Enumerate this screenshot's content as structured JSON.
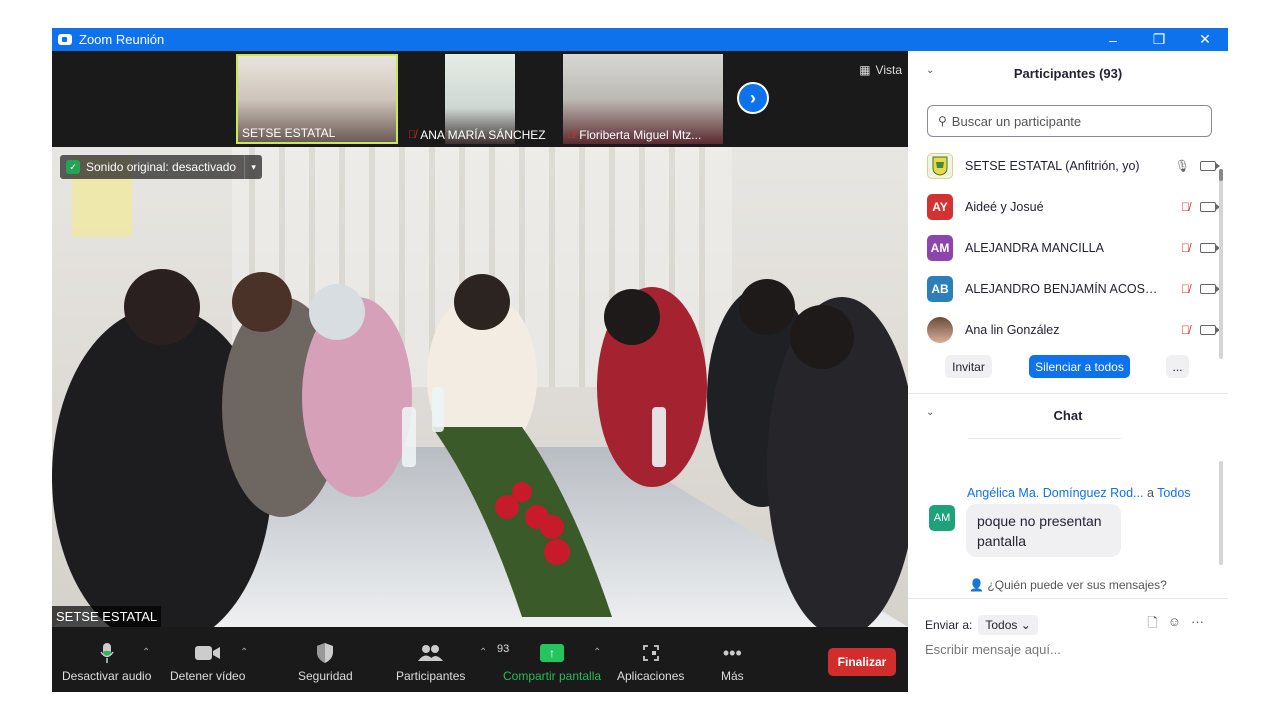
{
  "window": {
    "title": "Zoom Reunión",
    "controls": {
      "minimize": "–",
      "restore": "❐",
      "close": "✕"
    }
  },
  "strip": {
    "thumbnails": [
      {
        "label": "SETSE ESTATAL",
        "muted": false
      },
      {
        "label": "ANA MARÍA SÁNCHEZ",
        "muted": true
      },
      {
        "label": "Floriberta Miguel Mtz...",
        "muted": true
      }
    ],
    "view_label": "Vista"
  },
  "main_video": {
    "sound_status": "Sonido original: desactivado",
    "speaker_name": "SETSE ESTATAL"
  },
  "toolbar": {
    "audio_label": "Desactivar audio",
    "video_label": "Detener vídeo",
    "security_label": "Seguridad",
    "participants_label": "Participantes",
    "participants_count": "93",
    "share_label": "Compartir pantalla",
    "apps_label": "Aplicaciones",
    "more_label": "Más",
    "end_label": "Finalizar"
  },
  "participants_panel": {
    "title": "Participantes (93)",
    "search_placeholder": "Buscar un participante",
    "items": [
      {
        "initials": "",
        "name": "SETSE ESTATAL (Anfitrión, yo)",
        "color": "#f1f5e0",
        "muted": false
      },
      {
        "initials": "AY",
        "name": "Aideé y Josué",
        "color": "#d23232",
        "muted": true
      },
      {
        "initials": "AM",
        "name": "ALEJANDRA MANCILLA",
        "color": "#8e44ad",
        "muted": true
      },
      {
        "initials": "AB",
        "name": "ALEJANDRO BENJAMÍN ACOST...",
        "color": "#2c7fb8",
        "muted": true
      },
      {
        "initials": "",
        "name": "Ana lin González",
        "color": "#b07a5a",
        "muted": true
      }
    ],
    "invite_label": "Invitar",
    "mute_all_label": "Silenciar a todos",
    "more_label": "..."
  },
  "chat_panel": {
    "title": "Chat",
    "message": {
      "sender": "Angélica Ma. Domínguez Rod...",
      "to_prefix": "a",
      "to": "Todos",
      "avatar_initials": "AM",
      "text": "poque no presentan pantalla"
    },
    "who_sees": "¿Quién puede ver sus mensajes?",
    "send_to_label": "Enviar a:",
    "send_to_value": "Todos",
    "compose_placeholder": "Escribir mensaje aquí..."
  }
}
